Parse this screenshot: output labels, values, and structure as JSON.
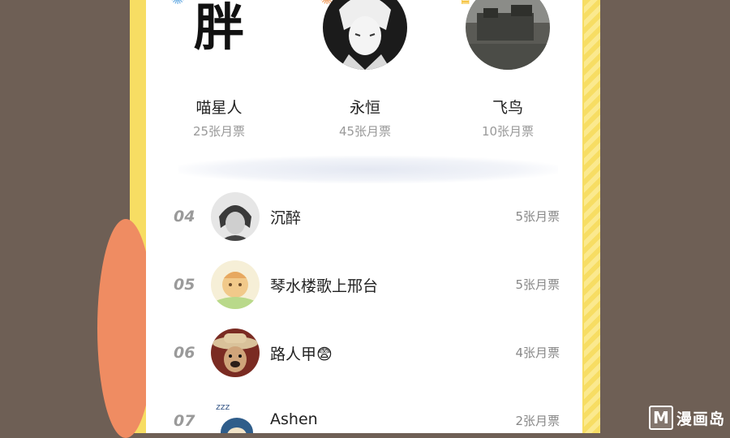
{
  "top3": [
    {
      "name": "喵星人",
      "votes": "25张月票",
      "avatar_glyph": "胖"
    },
    {
      "name": "永恒",
      "votes": "45张月票"
    },
    {
      "name": "飞鸟",
      "votes": "10张月票"
    }
  ],
  "list": [
    {
      "rank": "04",
      "name": "沉醉",
      "votes": "5张月票"
    },
    {
      "rank": "05",
      "name": "琴水楼歌上邢台",
      "votes": "5张月票"
    },
    {
      "rank": "06",
      "name": "路人甲😨",
      "votes": "4张月票"
    },
    {
      "rank": "07",
      "name": "Ashen",
      "votes": "2张月票"
    }
  ],
  "watermark": {
    "letter": "M",
    "text": "漫画岛"
  },
  "colors": {
    "frame": "#f7dd63",
    "background": "#6e5f55",
    "accent": "#ef8c62"
  }
}
